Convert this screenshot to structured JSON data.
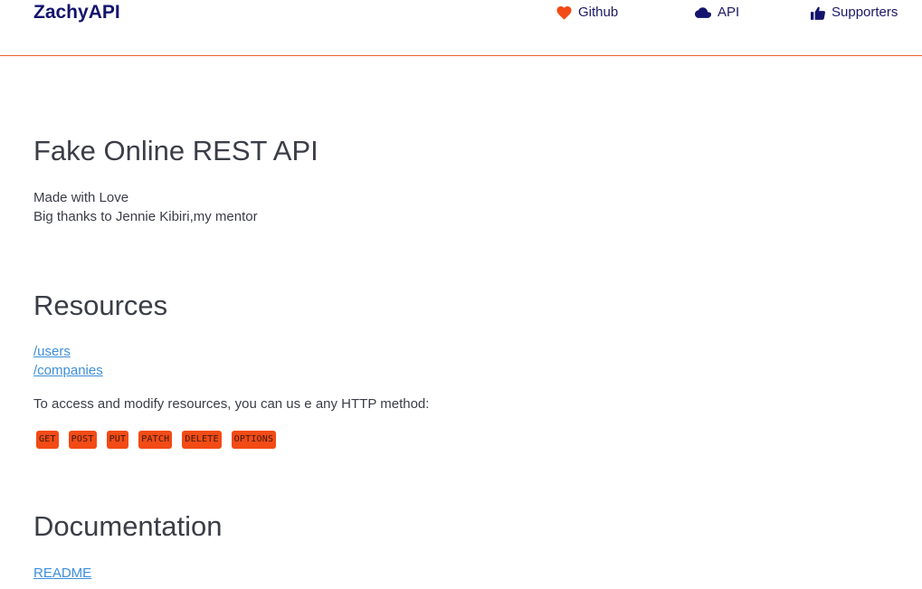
{
  "navbar": {
    "brand": "ZachyAPI",
    "links": [
      {
        "label": "Github",
        "icon": "heart-icon",
        "icon_color": "#f24b16"
      },
      {
        "label": "API",
        "icon": "cloud-icon",
        "icon_color": "#14146e"
      },
      {
        "label": "Supporters",
        "icon": "thumbs-up-icon",
        "icon_color": "#14146e"
      }
    ],
    "border_color": "#e8642c"
  },
  "hero": {
    "title": "Fake Online REST API",
    "line1": "Made with Love",
    "line2": "Big thanks to Jennie Kibiri,my mentor"
  },
  "resources": {
    "title": "Resources",
    "links": [
      "/users",
      "/companies"
    ],
    "access_text": "To access and modify resources, you can us e any HTTP method:",
    "methods": [
      "GET",
      "POST",
      "PUT",
      "PATCH",
      "DELETE",
      "OPTIONS"
    ],
    "method_color": "#f24b16"
  },
  "documentation": {
    "title": "Documentation",
    "link": "README"
  },
  "colors": {
    "link": "#3d8fd9",
    "text": "#3b3d47",
    "brand": "#14146e"
  }
}
